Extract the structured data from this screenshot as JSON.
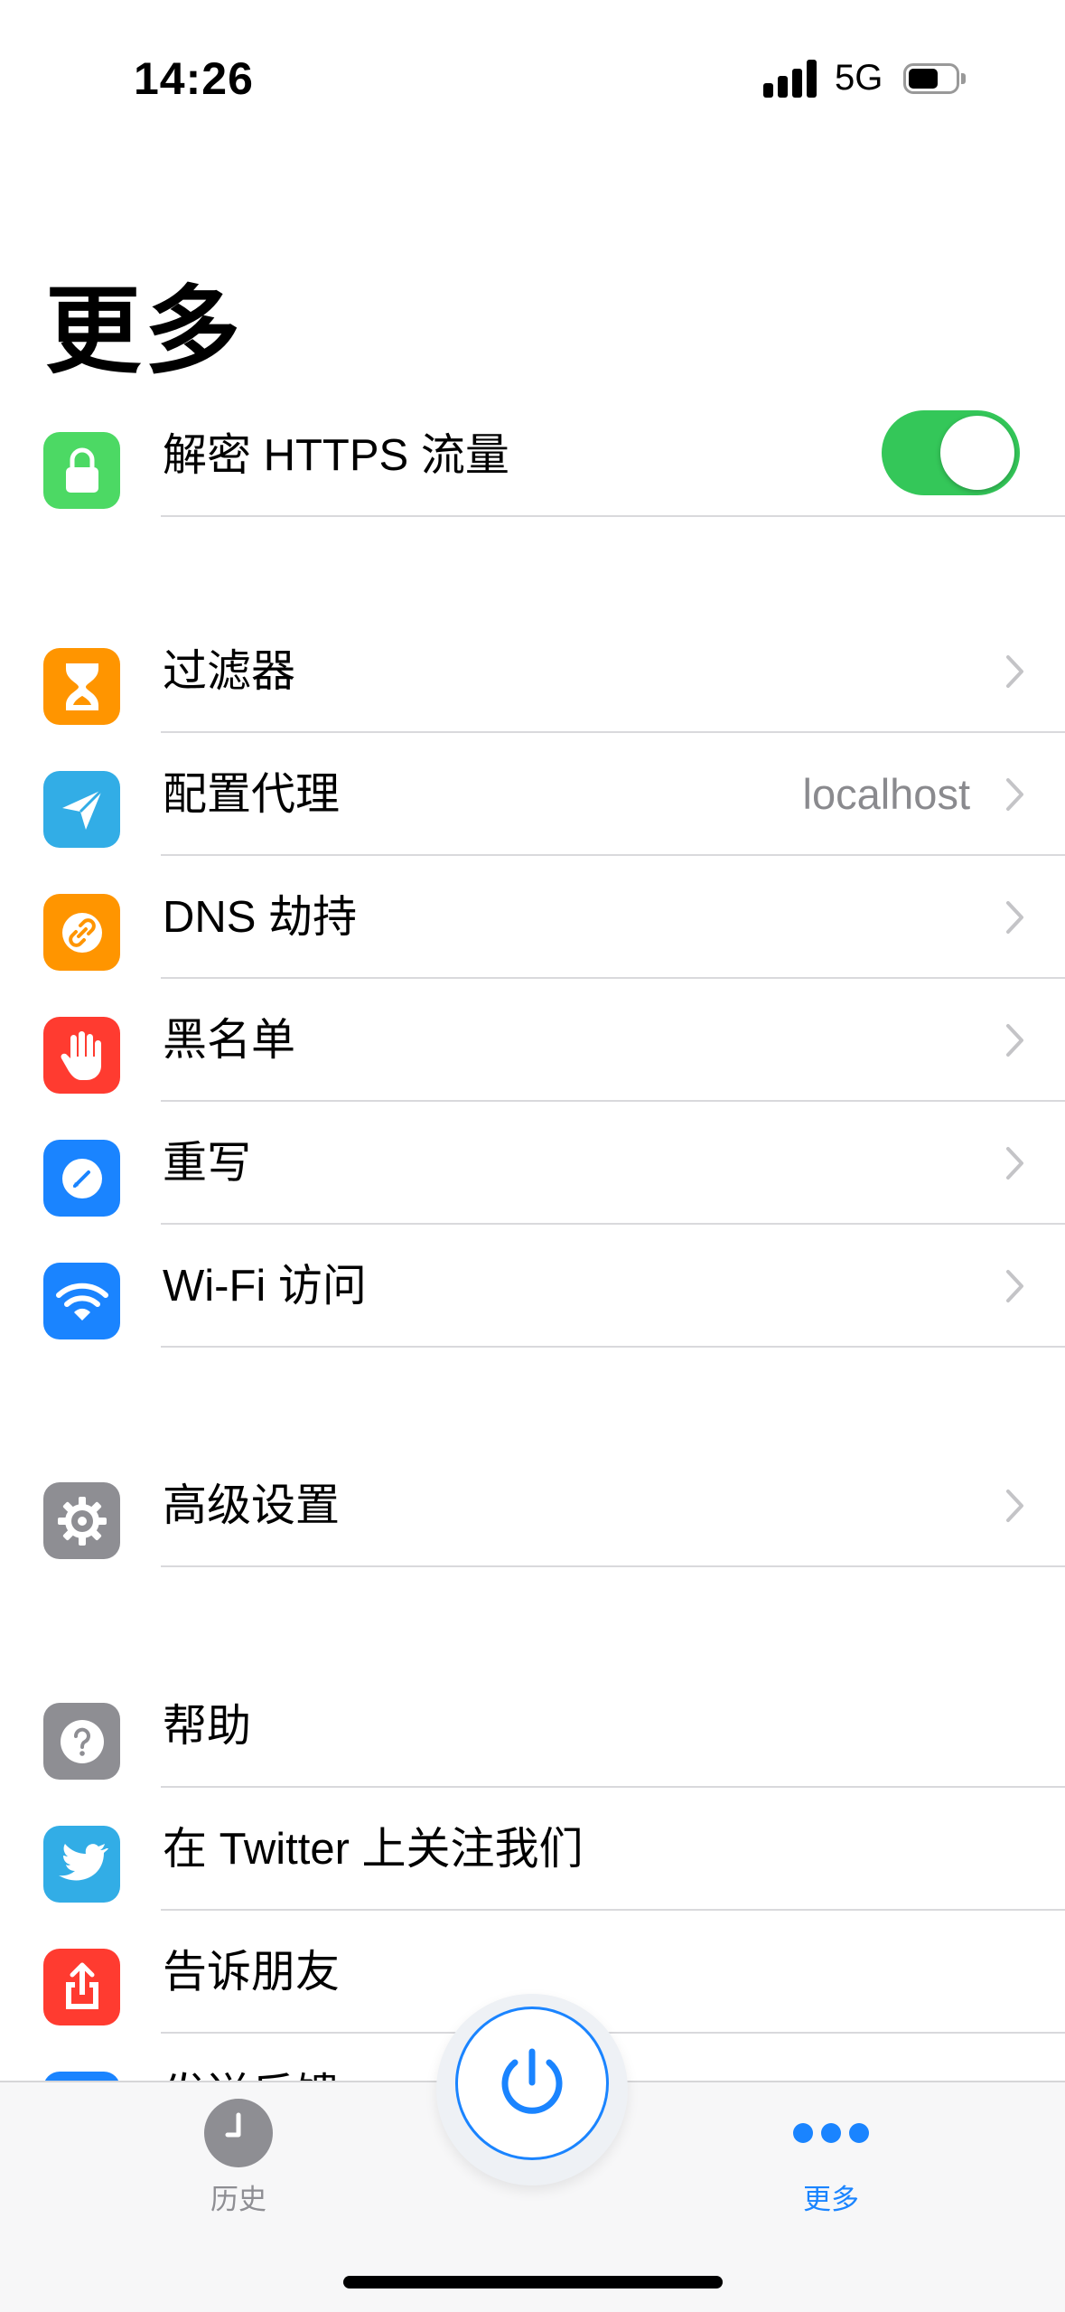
{
  "status_bar": {
    "time": "14:26",
    "network": "5G"
  },
  "page_title": "更多",
  "https_row": {
    "label": "解密 HTTPS 流量",
    "toggle_on": true,
    "icon": "lock-icon",
    "color": "#4cd964"
  },
  "section_tools": [
    {
      "label": "过滤器",
      "icon": "hourglass-icon",
      "color": "#ff9500"
    },
    {
      "label": "配置代理",
      "value": "localhost",
      "icon": "paper-plane-icon",
      "color": "#32ade6"
    },
    {
      "label": "DNS 劫持",
      "icon": "link-icon",
      "color": "#ff9500"
    },
    {
      "label": "黑名单",
      "icon": "hand-icon",
      "color": "#ff3b30"
    },
    {
      "label": "重写",
      "icon": "pencil-icon",
      "color": "#1a84ff"
    },
    {
      "label": "Wi-Fi 访问",
      "icon": "wifi-icon",
      "color": "#1a84ff"
    }
  ],
  "section_advanced": [
    {
      "label": "高级设置",
      "icon": "gear-icon",
      "color": "#8e8e93"
    }
  ],
  "section_support": [
    {
      "label": "帮助",
      "icon": "question-icon",
      "color": "#8e8e93"
    },
    {
      "label": "在 Twitter 上关注我们",
      "icon": "twitter-icon",
      "color": "#32ade6"
    },
    {
      "label": "告诉朋友",
      "icon": "share-icon",
      "color": "#ff3b30"
    },
    {
      "label": "发送反馈",
      "icon": "mail-icon",
      "color": "#1a84ff"
    }
  ],
  "tab_bar": {
    "history_label": "历史",
    "more_label": "更多",
    "active_color": "#1a84ff",
    "inactive_color": "#8e8e93"
  }
}
